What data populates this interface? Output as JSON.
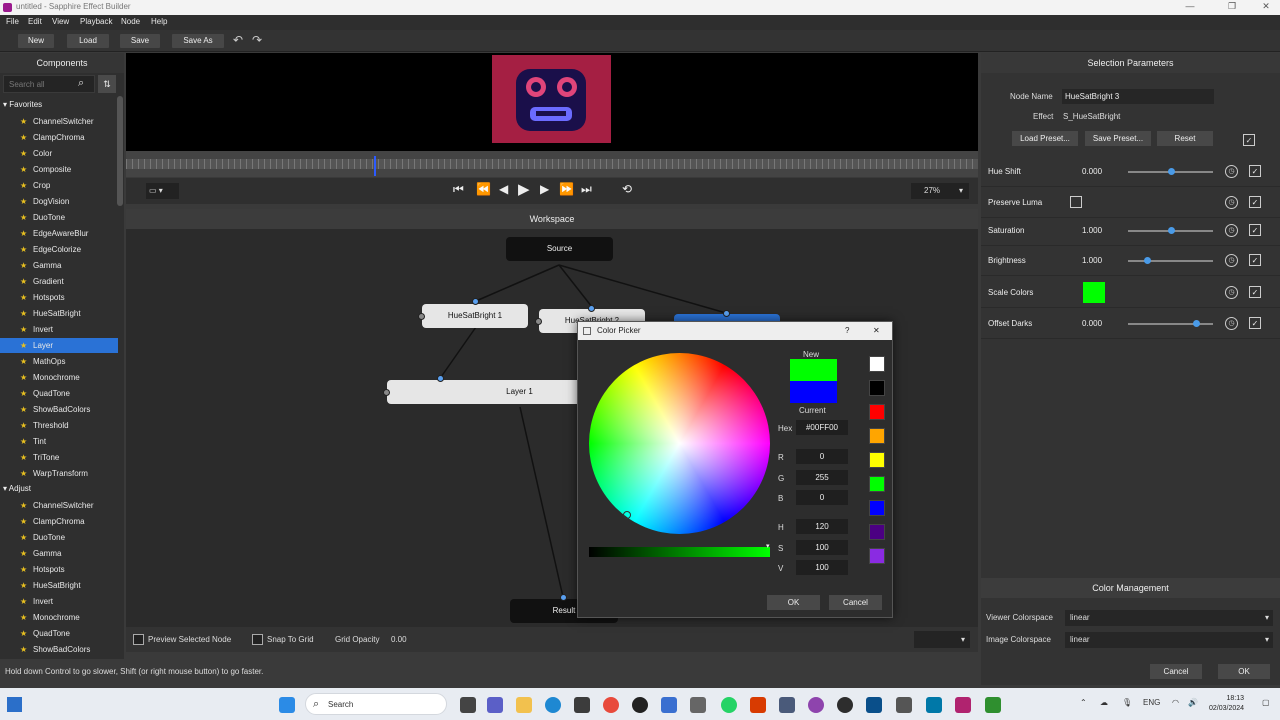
{
  "window": {
    "title": "untitled - Sapphire Effect Builder",
    "minimize": "—",
    "maximize": "❐",
    "close": "✕"
  },
  "menu": [
    "File",
    "Edit",
    "View",
    "Playback",
    "Node",
    "Help"
  ],
  "toolbar": {
    "new": "New",
    "load": "Load",
    "save": "Save",
    "save_as": "Save As",
    "undo": "↶",
    "redo": "↷"
  },
  "components": {
    "header": "Components",
    "search_placeholder": "Search all",
    "groups": [
      {
        "label": "Favorites",
        "items": [
          "ChannelSwitcher",
          "ClampChroma",
          "Color",
          "Composite",
          "Crop",
          "DogVision",
          "DuoTone",
          "EdgeAwareBlur",
          "EdgeColorize",
          "Gamma",
          "Gradient",
          "Hotspots",
          "HueSatBright",
          "Invert",
          "Layer",
          "MathOps",
          "Monochrome",
          "QuadTone",
          "ShowBadColors",
          "Threshold",
          "Tint",
          "TriTone",
          "WarpTransform"
        ]
      },
      {
        "label": "Adjust",
        "items": [
          "ChannelSwitcher",
          "ClampChroma",
          "DuoTone",
          "Gamma",
          "Hotspots",
          "HueSatBright",
          "Invert",
          "Monochrome",
          "QuadTone",
          "ShowBadColors"
        ]
      }
    ],
    "selected": "Layer"
  },
  "transport": {
    "zoom": "27%",
    "aspect": "▭ ▾"
  },
  "workspace": {
    "header": "Workspace",
    "nodes": {
      "source": "Source",
      "hsb1": "HueSatBright 1",
      "hsb2": "HueSatBright 2",
      "layer1": "Layer 1",
      "result": "Result"
    },
    "preview_selected": "Preview Selected Node",
    "snap_to_grid": "Snap To Grid",
    "grid_opacity_label": "Grid Opacity",
    "grid_opacity_value": "0.00"
  },
  "status": "Hold down Control to go slower, Shift (or right mouse button) to go faster.",
  "selection": {
    "header": "Selection Parameters",
    "node_name_label": "Node Name",
    "node_name": "HueSatBright 3",
    "effect_label": "Effect",
    "effect": "S_HueSatBright",
    "load_preset": "Load Preset...",
    "save_preset": "Save Preset...",
    "reset": "Reset",
    "params": [
      {
        "label": "Hue Shift",
        "value": "0.000",
        "slider": 0.5
      },
      {
        "label": "Preserve Luma",
        "value": ""
      },
      {
        "label": "Saturation",
        "value": "1.000",
        "slider": 0.5
      },
      {
        "label": "Brightness",
        "value": "1.000",
        "slider": 0.22
      },
      {
        "label": "Scale Colors",
        "value": ""
      },
      {
        "label": "Offset Darks",
        "value": "0.000",
        "slider": 0.8
      }
    ],
    "scale_color": "#00ff00"
  },
  "color_management": {
    "header": "Color Management",
    "viewer_label": "Viewer Colorspace",
    "viewer_value": "linear",
    "image_label": "Image Colorspace",
    "image_value": "linear"
  },
  "footer": {
    "cancel": "Cancel",
    "ok": "OK"
  },
  "color_picker": {
    "title": "Color Picker",
    "help": "?",
    "close": "✕",
    "new_label": "New",
    "current_label": "Current",
    "new_color": "#00ff00",
    "current_color": "#0000ff",
    "hex_label": "Hex",
    "hex": "#00FF00",
    "r_label": "R",
    "r": "0",
    "g_label": "G",
    "g": "255",
    "b_label": "B",
    "b": "0",
    "h_label": "H",
    "h": "120",
    "s_label": "S",
    "s": "100",
    "v_label": "V",
    "v": "100",
    "palette": [
      "#ffffff",
      "#000000",
      "#ff0000",
      "#ffa500",
      "#ffff00",
      "#00ff00",
      "#0000ff",
      "#4b0082",
      "#8a2be2"
    ],
    "ok": "OK",
    "cancel": "Cancel"
  },
  "taskbar": {
    "search": "Search",
    "lang": "ENG",
    "time": "18:13",
    "date": "02/03/2024"
  }
}
